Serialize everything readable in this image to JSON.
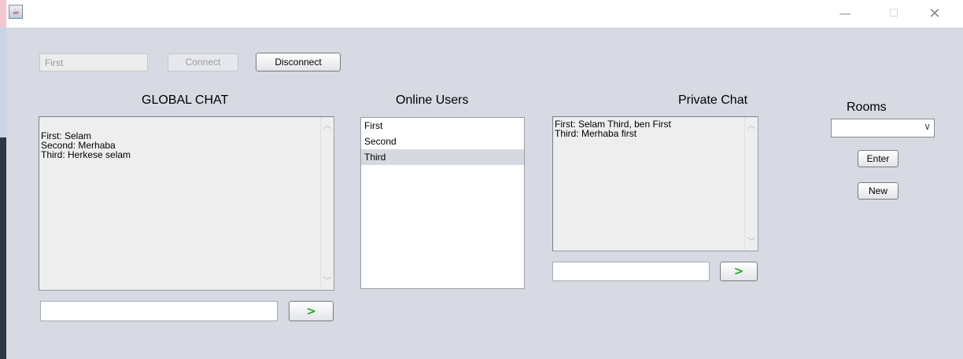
{
  "window": {
    "title": "",
    "controls": {
      "minimize": "—",
      "maximize": "☐",
      "close": "✕"
    }
  },
  "connection": {
    "username_value": "First",
    "connect_label": "Connect",
    "disconnect_label": "Disconnect"
  },
  "global_chat": {
    "title": "GLOBAL CHAT",
    "messages": "First: Selam\nSecond: Merhaba\nThird: Herkese selam",
    "input_value": "",
    "send_label": ">"
  },
  "online_users": {
    "title": "Online Users",
    "users": [
      "First",
      "Second",
      "Third"
    ],
    "selected": "Third"
  },
  "private_chat": {
    "title": "Private Chat",
    "messages": "First: Selam Third, ben First\nThird: Merhaba first",
    "input_value": "",
    "send_label": ">"
  },
  "rooms": {
    "title": "Rooms",
    "selected_room": "",
    "enter_label": "Enter",
    "new_label": "New"
  },
  "colors": {
    "window_bg": "#d7dae2",
    "send_arrow": "#1fa81f",
    "selected_row": "#d6d9df"
  }
}
